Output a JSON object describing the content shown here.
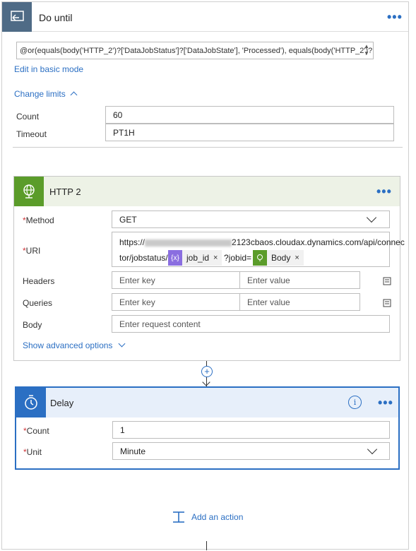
{
  "do_until": {
    "title": "Do until",
    "expression_line1": "@or(equals(body('HTTP_2')?['DataJobStatus']?['DataJobState'], 'Processed'), equals(body('HTTP_2')?",
    "edit_basic_mode": "Edit in basic mode",
    "change_limits": "Change limits",
    "count_label": "Count",
    "count_value": "60",
    "timeout_label": "Timeout",
    "timeout_value": "PT1H"
  },
  "http": {
    "title": "HTTP 2",
    "method_label": "Method",
    "method_value": "GET",
    "uri_label": "URI",
    "uri_line1_prefix": "https://",
    "uri_line1_suffix": "2123cbaos.cloudax.dynamics.com/api/connec",
    "uri_line2_prefix": "tor/jobstatus/",
    "token_job_id": "job_id",
    "uri_query": "?jobid=",
    "token_body": "Body",
    "token_close": "×",
    "headers_label": "Headers",
    "queries_label": "Queries",
    "body_label": "Body",
    "enter_key": "Enter key",
    "enter_value": "Enter value",
    "enter_request_content": "Enter request content",
    "show_advanced": "Show advanced options"
  },
  "delay": {
    "title": "Delay",
    "count_label": "Count",
    "count_value": "1",
    "unit_label": "Unit",
    "unit_value": "Minute"
  },
  "add_action": "Add an action",
  "required_marker": "*",
  "colors": {
    "accent_blue": "#2b6fc3",
    "do_until_header": "#4f6b86",
    "http_green": "#5b9c2a",
    "token_purple": "#8a6ee0"
  }
}
